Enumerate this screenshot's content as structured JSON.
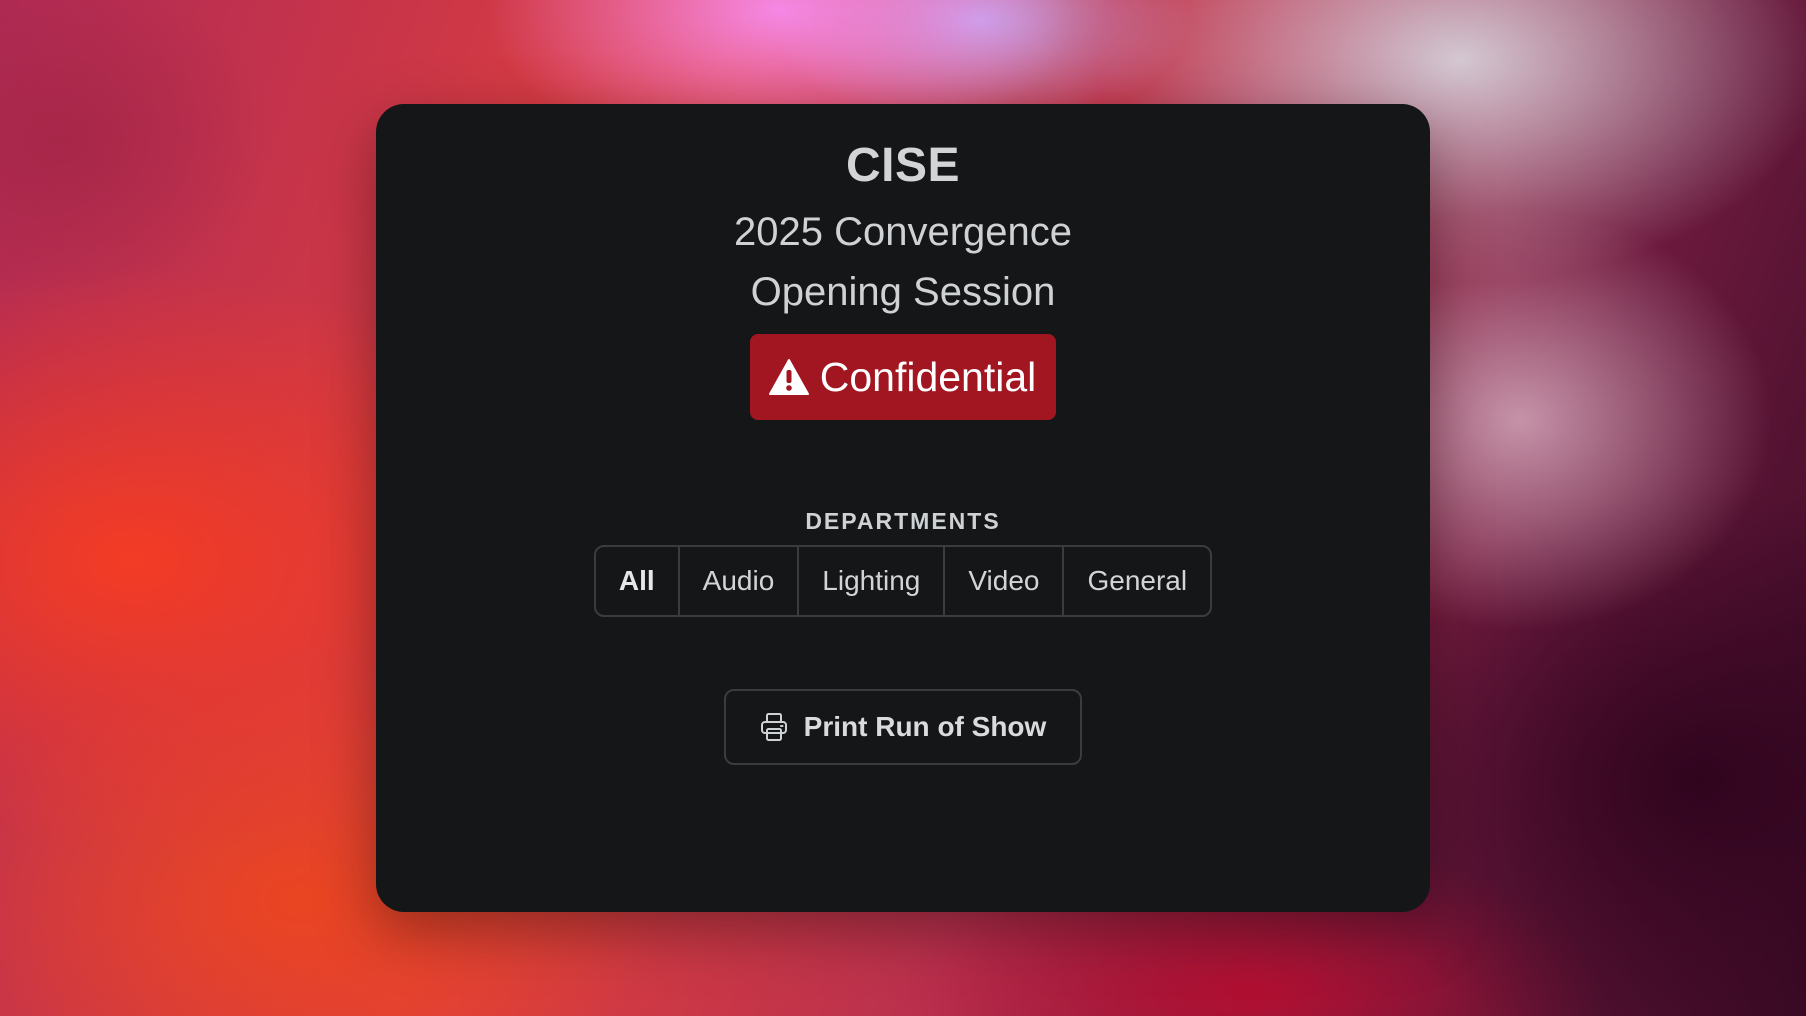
{
  "header": {
    "org": "CISE",
    "event": "2025 Convergence",
    "session": "Opening Session"
  },
  "badge": {
    "label": "Confidential",
    "icon": "warning-icon",
    "color": "#a11621"
  },
  "departments": {
    "heading": "DEPARTMENTS",
    "selected": "All",
    "items": [
      "All",
      "Audio",
      "Lighting",
      "Video",
      "General"
    ]
  },
  "actions": {
    "print_label": "Print Run of Show",
    "print_icon": "printer-icon"
  },
  "colors": {
    "card_background": "#141617",
    "border": "#3a3d40"
  }
}
